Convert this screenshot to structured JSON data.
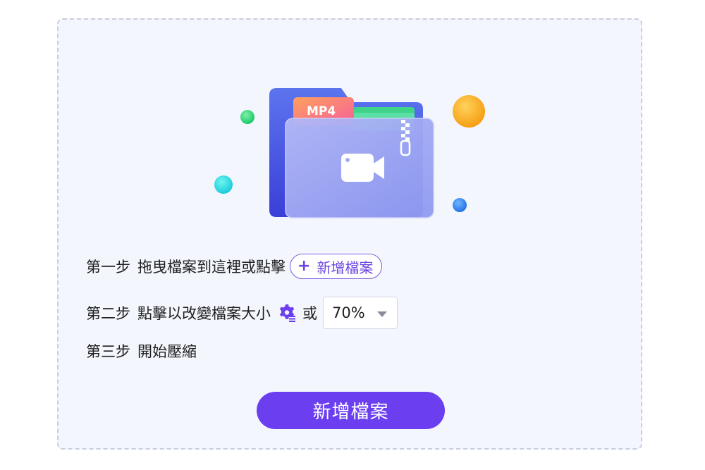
{
  "illustration": {
    "folder_tab_text": "MP4"
  },
  "steps": [
    {
      "label": "第一步",
      "text": "拖曳檔案到這裡或點擊",
      "button_label": "新增檔案"
    },
    {
      "label": "第二步",
      "text": "點擊以改變檔案大小",
      "or_text": "或",
      "select_value": "70%"
    },
    {
      "label": "第三步",
      "text": "開始壓縮"
    }
  ],
  "primary_button": {
    "label": "新增檔案"
  },
  "colors": {
    "accent": "#6b3ff0",
    "dropzone_bg": "#f3f6fd",
    "dropzone_border": "#c9cde0"
  }
}
